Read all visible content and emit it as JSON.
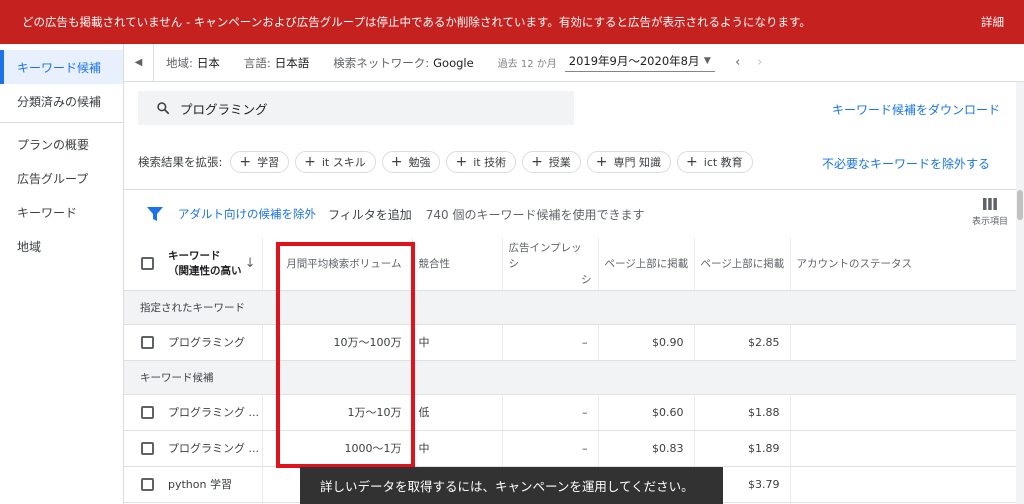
{
  "banner": {
    "message": "どの広告も掲載されていません - キャンペーンおよび広告グループは停止中であるか削除されています。有効にすると広告が表示されるようになります。",
    "details_link": "詳細",
    "color": "#c5221f"
  },
  "sidebar": {
    "items": [
      {
        "label": "キーワード候補",
        "active": true
      },
      {
        "label": "分類済みの候補",
        "active": false
      },
      {
        "label": "プランの概要",
        "active": false
      },
      {
        "label": "広告グループ",
        "active": false
      },
      {
        "label": "キーワード",
        "active": false
      },
      {
        "label": "地域",
        "active": false
      }
    ]
  },
  "filters": {
    "location_label": "地域:",
    "location_value": "日本",
    "language_label": "言語:",
    "language_value": "日本語",
    "network_label": "検索ネットワーク:",
    "network_value": "Google",
    "period_label": "過去 12 か月",
    "period_value": "2019年9月～2020年8月"
  },
  "search": {
    "value": "プログラミング",
    "download_link": "キーワード候補をダウンロード"
  },
  "expand": {
    "label": "検索結果を拡張:",
    "chips": [
      "学習",
      "it スキル",
      "勉強",
      "it 技術",
      "授業",
      "専門 知識",
      "ict 教育"
    ],
    "exclude_link": "不必要なキーワードを除外する"
  },
  "toolbar": {
    "exclude_adult": "アダルト向けの候補を除外",
    "add_filter": "フィルタを追加",
    "count_text": "740 個のキーワード候補を使用できます",
    "columns_label": "表示項目"
  },
  "table": {
    "headers": {
      "keyword": "キーワード",
      "keyword_sub": "（関連性の高い",
      "volume": "月間平均検索ボリューム",
      "competition": "競合性",
      "impression_share": "広告インプレッシ",
      "impression_share_2": "シ",
      "top_bid_low": "ページ上部に掲載",
      "top_bid_high": "ページ上部に掲載",
      "account_status": "アカウントのステータス"
    },
    "group_provided": "指定されたキーワード",
    "group_ideas": "キーワード候補",
    "provided_rows": [
      {
        "keyword": "プログラミング",
        "volume": "10万～100万",
        "competition": "中",
        "impression": "–",
        "low": "$0.90",
        "high": "$2.85"
      }
    ],
    "idea_rows": [
      {
        "keyword": "プログラミング ...",
        "volume": "1万～10万",
        "competition": "低",
        "impression": "–",
        "low": "$0.60",
        "high": "$1.88"
      },
      {
        "keyword": "プログラミング ...",
        "volume": "1000～1万",
        "competition": "中",
        "impression": "–",
        "low": "$0.83",
        "high": "$1.89"
      },
      {
        "keyword": "python 学習",
        "volume": "",
        "competition": "",
        "impression": "",
        "low": "",
        "high": "$3.79"
      }
    ]
  },
  "toast": {
    "message": "詳しいデータを取得するには、キャンペーンを運用してください。"
  },
  "colors": {
    "accent": "#1a73e8",
    "highlight": "#e0131d"
  }
}
